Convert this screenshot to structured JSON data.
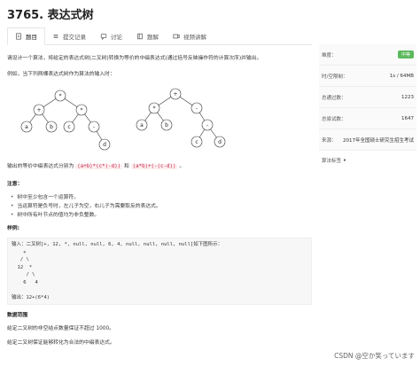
{
  "title": "3765. 表达式树",
  "tabs": [
    {
      "label": "题目",
      "icon": "document-icon"
    },
    {
      "label": "提交记录",
      "icon": "list-icon"
    },
    {
      "label": "讨论",
      "icon": "chat-icon"
    },
    {
      "label": "题解",
      "icon": "book-icon"
    },
    {
      "label": "视频讲解",
      "icon": "video-icon"
    }
  ],
  "problem": {
    "intro": "请设计一个算法，将给定的表达式树(二叉树)转换为等价的中缀表达式(通过括号反映操作符的计算次序)并输出。",
    "example_intro": "例如，当下列两棵表达式树作为算法的输入时：",
    "output_prefix": "输出的等价中缀表达式分别为",
    "output_expr1": "(a+b)*(c*(-d))",
    "output_and": "和",
    "output_expr2": "(a*b)+(-(c-d))",
    "output_suffix": "。",
    "notes_heading": "注意：",
    "notes": [
      "树中至少包含一个运算符。",
      "当运算符是负号时，左儿子为空，右儿子为需要取反的表达式。",
      "树中所有叶节点的值均为非负整数。"
    ],
    "sample_heading": "样例:",
    "sample_lines": [
      "输入：二叉树[+, 12, *, null, null, 6, 4, null, null, null, null]如下图所示：",
      "    +",
      "   / \\",
      "  12  *",
      "     / \\",
      "    6   4",
      "",
      "输出：12+(6*4)"
    ],
    "range_heading": "数据范围",
    "range_lines": [
      "给定二叉树的非空结点数量保证不超过 1000。",
      "给定二叉树保证能够转化为合法的中缀表达式。"
    ]
  },
  "tree1": {
    "root": "*",
    "l": "+",
    "r": "*",
    "ll": "a",
    "lr": "b",
    "rl": "c",
    "rr": "-",
    "rrr": "d"
  },
  "tree2": {
    "root": "+",
    "l": "*",
    "r": "-",
    "ll": "a",
    "lr": "b",
    "rr": "-",
    "rrl": "c",
    "rrr": "d"
  },
  "sidebar": {
    "difficulty_label": "难度：",
    "difficulty_value": "中等",
    "limits_label": "时/空限制：",
    "limits_value": "1s / 64MB",
    "passed_label": "总通过数：",
    "passed_value": "1223",
    "attempts_label": "总尝试数：",
    "attempts_value": "1647",
    "source_label": "来源：",
    "source_value": "2017年全国硕士研究生招生考试",
    "tags_label": "算法标签",
    "tags_toggle": "▸"
  },
  "watermark": "CSDN @空か笑っています",
  "colors": {
    "easy_green": "#5cb85c",
    "code_red": "#c7254e",
    "code_bg": "#fdeeee"
  }
}
